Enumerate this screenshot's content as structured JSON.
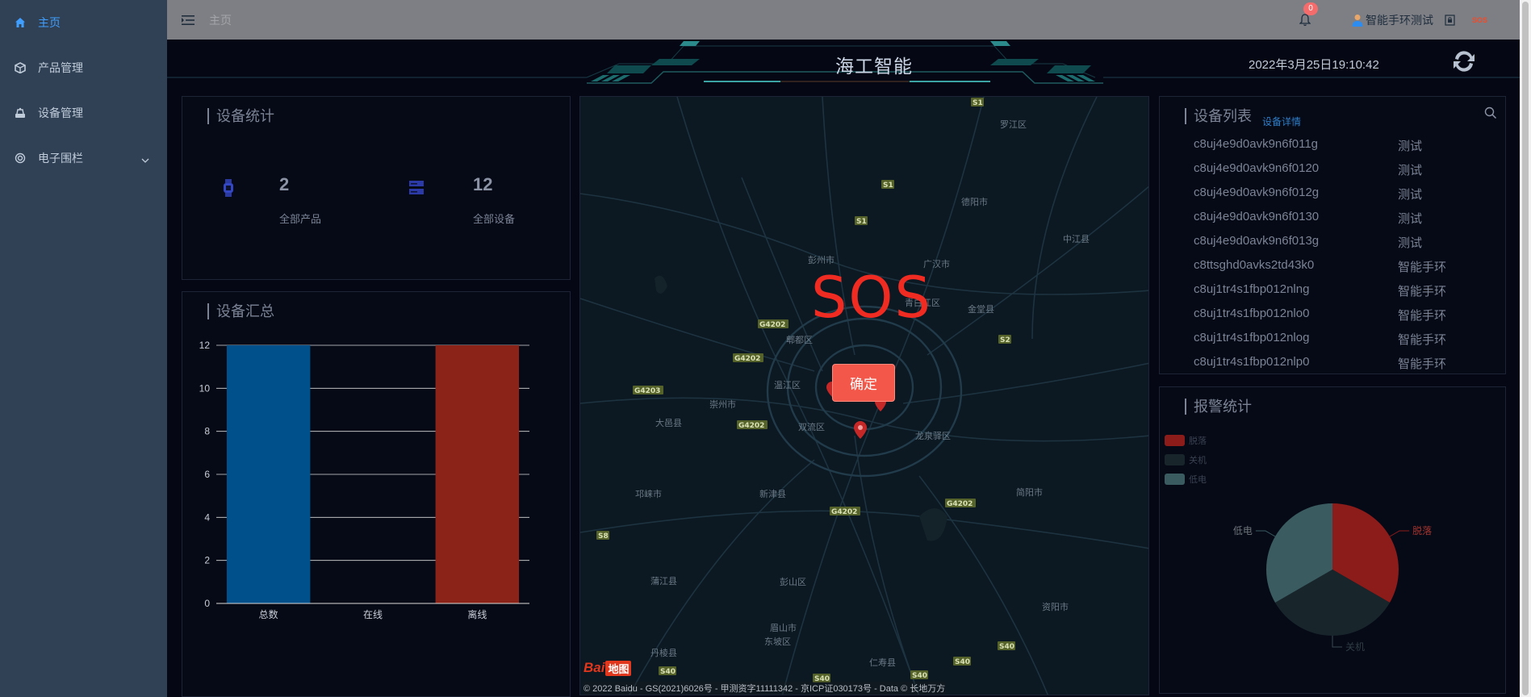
{
  "sidebar": {
    "items": [
      {
        "label": "主页"
      },
      {
        "label": "产品管理"
      },
      {
        "label": "设备管理"
      },
      {
        "label": "电子围栏"
      }
    ]
  },
  "topbar": {
    "breadcrumb": "主页",
    "notification_count": "0",
    "user_name": "智能手环测试",
    "sos_label": "SOS"
  },
  "dashboard": {
    "title": "海工智能",
    "datetime": "2022年3月25日19:10:42"
  },
  "device_stats": {
    "title": "设备统计",
    "products_count": "2",
    "products_label": "全部产品",
    "devices_count": "12",
    "devices_label": "全部设备"
  },
  "summary": {
    "title": "设备汇总"
  },
  "map": {
    "sos_text": "SOS",
    "confirm_label": "确定",
    "copyright": "© 2022 Baidu - GS(2021)6026号 - 甲测资字11111342 - 京ICP证030173号 - Data © 长地万方",
    "logo_text": "Bai",
    "logo_suffix": "地图",
    "place_labels": [
      "罗江区",
      "德阳市",
      "中江县",
      "彭州市",
      "广汉市",
      "青白江区",
      "金堂县",
      "郫都区",
      "温江区",
      "崇州市",
      "大邑县",
      "双流区",
      "龙泉驿区",
      "邛崃市",
      "新津县",
      "简阳市",
      "蒲江县",
      "彭山区",
      "眉山市",
      "东坡区",
      "资阳市",
      "丹棱县",
      "仁寿县"
    ],
    "road_labels": [
      "S1",
      "S1",
      "S1",
      "G4202",
      "G4202",
      "G4203",
      "G4202",
      "G4202",
      "G4202",
      "S2",
      "S8",
      "S40",
      "S40",
      "S40",
      "S40",
      "S40"
    ]
  },
  "device_list": {
    "title": "设备列表",
    "details_link": "设备详情",
    "rows": [
      {
        "id": "c8uj4e9d0avk9n6f011g",
        "type": "测试"
      },
      {
        "id": "c8uj4e9d0avk9n6f0120",
        "type": "测试"
      },
      {
        "id": "c8uj4e9d0avk9n6f012g",
        "type": "测试"
      },
      {
        "id": "c8uj4e9d0avk9n6f0130",
        "type": "测试"
      },
      {
        "id": "c8uj4e9d0avk9n6f013g",
        "type": "测试"
      },
      {
        "id": "c8ttsghd0avks2td43k0",
        "type": "智能手环"
      },
      {
        "id": "c8uj1tr4s1fbp012nlng",
        "type": "智能手环"
      },
      {
        "id": "c8uj1tr4s1fbp012nlo0",
        "type": "智能手环"
      },
      {
        "id": "c8uj1tr4s1fbp012nlog",
        "type": "智能手环"
      },
      {
        "id": "c8uj1tr4s1fbp012nlp0",
        "type": "智能手环"
      }
    ]
  },
  "alarm_stats": {
    "title": "报警统计"
  },
  "chart_data": [
    {
      "type": "bar",
      "categories": [
        "总数",
        "在线",
        "离线"
      ],
      "values": [
        12,
        0,
        12
      ],
      "colors": [
        "#00508c",
        "#1a1a2a",
        "#8b2318"
      ],
      "ylim": [
        0,
        12
      ],
      "yticks": [
        "0",
        "2",
        "4",
        "6",
        "8",
        "10",
        "12"
      ],
      "grid": true
    },
    {
      "type": "pie",
      "legend": [
        "脱落",
        "关机",
        "低电"
      ],
      "labels": [
        "脱落",
        "关机",
        "低电"
      ],
      "values": [
        1,
        1,
        1
      ],
      "colors": [
        "#8c1c1a",
        "#18262c",
        "#3a5c60"
      ]
    }
  ]
}
